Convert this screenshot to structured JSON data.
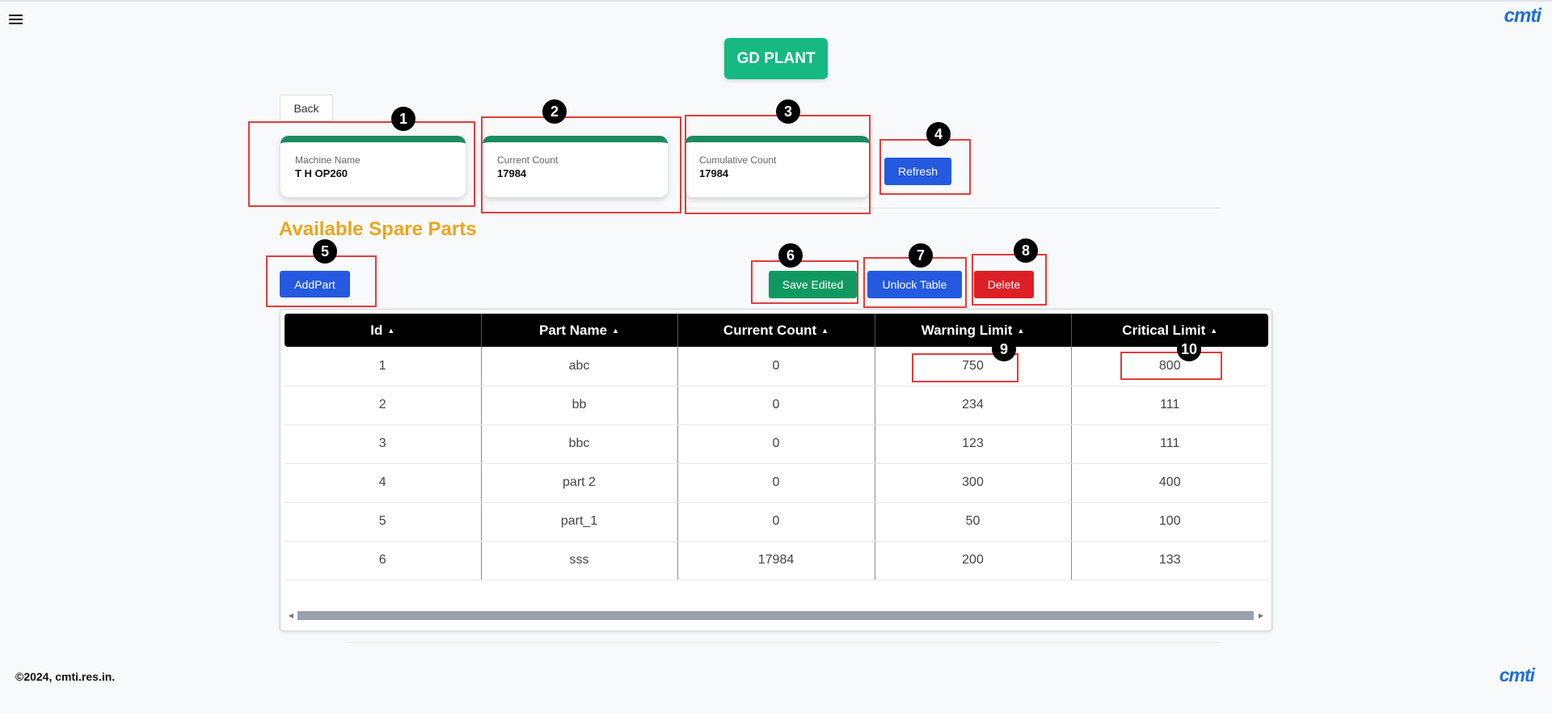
{
  "header": {
    "plant_label": "GD PLANT",
    "logo_text": "cmti"
  },
  "nav": {
    "back_label": "Back"
  },
  "cards": [
    {
      "label": "Machine Name",
      "value": "T H OP260"
    },
    {
      "label": "Current Count",
      "value": "17984"
    },
    {
      "label": "Cumulative Count",
      "value": "17984"
    }
  ],
  "actions": {
    "refresh_label": "Refresh",
    "add_part_label": "AddPart",
    "save_edited_label": "Save Edited",
    "unlock_table_label": "Unlock Table",
    "delete_label": "Delete"
  },
  "section_title": "Available Spare Parts",
  "table": {
    "columns": [
      "Id",
      "Part Name",
      "Current Count",
      "Warning Limit",
      "Critical Limit"
    ],
    "rows": [
      [
        "1",
        "abc",
        "0",
        "750",
        "800"
      ],
      [
        "2",
        "bb",
        "0",
        "234",
        "111"
      ],
      [
        "3",
        "bbc",
        "0",
        "123",
        "111"
      ],
      [
        "4",
        "part 2",
        "0",
        "300",
        "400"
      ],
      [
        "5",
        "part_1",
        "0",
        "50",
        "100"
      ],
      [
        "6",
        "sss",
        "17984",
        "200",
        "133"
      ]
    ]
  },
  "annotations": [
    "1",
    "2",
    "3",
    "4",
    "5",
    "6",
    "7",
    "8",
    "9",
    "10"
  ],
  "footer": {
    "copyright": "©2024, cmti.res.in."
  },
  "colors": {
    "plant_button": "#15b981",
    "card_accent": "#1b8a5f",
    "primary_blue": "#2459e0",
    "save_green": "#0f9960",
    "delete_red": "#dc1f26",
    "section_title": "#eca51d",
    "annotation_box": "#e23d3d"
  },
  "icons": {
    "menu": "hamburger-menu-icon",
    "sort": "sort-ascending-icon",
    "scroll_left": "scroll-left-arrow-icon",
    "scroll_right": "scroll-right-arrow-icon"
  }
}
